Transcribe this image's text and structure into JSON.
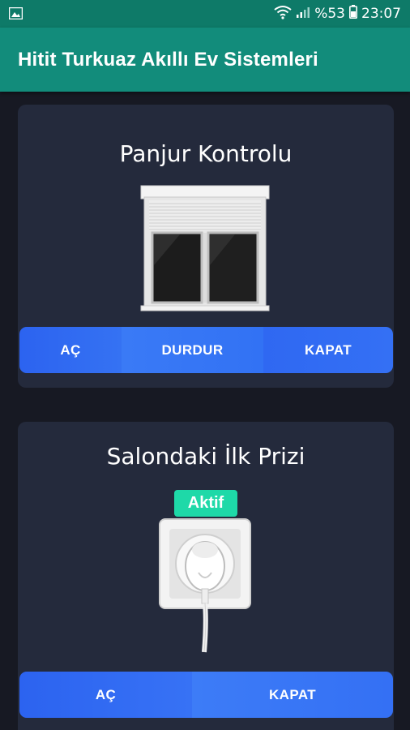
{
  "status_bar": {
    "battery_percent": "%53",
    "time": "23:07"
  },
  "app_bar": {
    "title": "Hitit Turkuaz Akıllı Ev Sistemleri"
  },
  "cards": [
    {
      "title": "Panjur Kontrolu",
      "buttons": [
        {
          "label": "AÇ"
        },
        {
          "label": "DURDUR"
        },
        {
          "label": "KAPAT"
        }
      ]
    },
    {
      "title": "Salondaki İlk Prizi",
      "status_badge": "Aktif",
      "buttons": [
        {
          "label": "AÇ"
        },
        {
          "label": "KAPAT"
        }
      ]
    }
  ],
  "colors": {
    "status_bar": "#0e7a68",
    "app_bar": "#128c7b",
    "background": "#171923",
    "card": "#242a3c",
    "button_blue_dark": "#2c63f0",
    "button_blue_light": "#3a7af6",
    "badge": "#1ed9a8"
  }
}
